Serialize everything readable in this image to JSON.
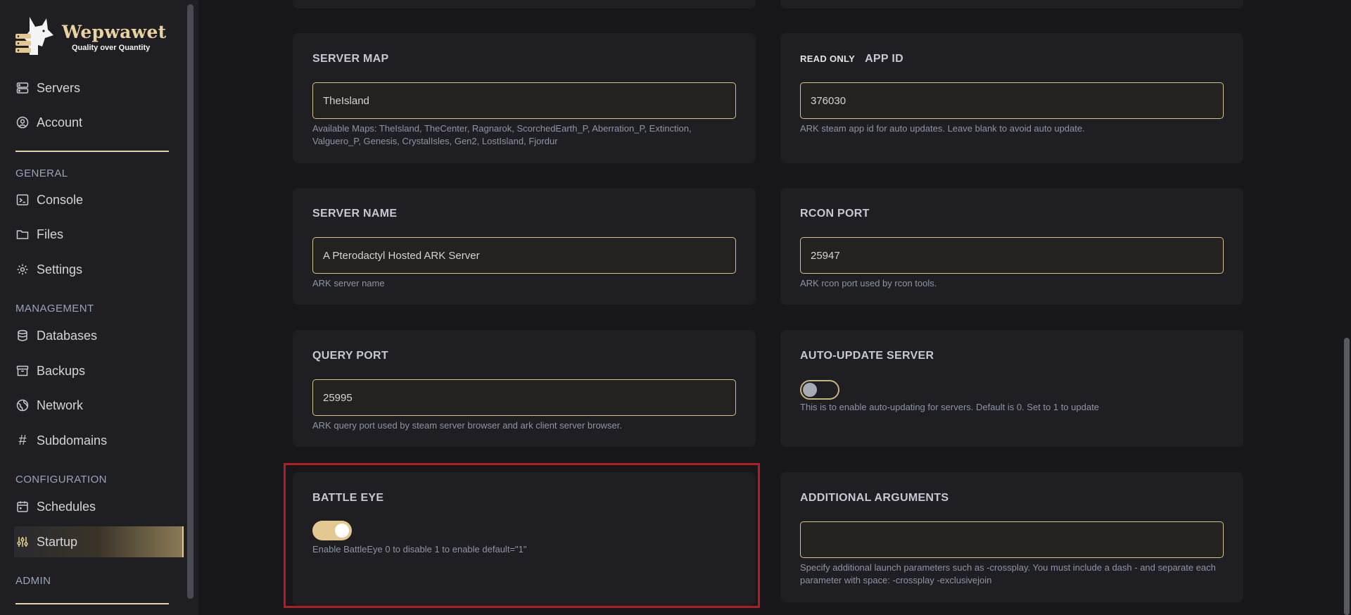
{
  "brand": {
    "name": "Wepwawet",
    "tagline": "Quality over Quantity"
  },
  "nav": {
    "top": [
      {
        "label": "Servers",
        "icon": "server-icon"
      },
      {
        "label": "Account",
        "icon": "account-icon"
      }
    ],
    "general_title": "GENERAL",
    "general": [
      {
        "label": "Console",
        "icon": "terminal-icon"
      },
      {
        "label": "Files",
        "icon": "folder-icon"
      },
      {
        "label": "Settings",
        "icon": "gear-icon"
      }
    ],
    "management_title": "MANAGEMENT",
    "management": [
      {
        "label": "Databases",
        "icon": "database-icon"
      },
      {
        "label": "Backups",
        "icon": "archive-icon"
      },
      {
        "label": "Network",
        "icon": "globe-icon"
      },
      {
        "label": "Subdomains",
        "icon": "hash-icon"
      }
    ],
    "configuration_title": "CONFIGURATION",
    "configuration": [
      {
        "label": "Schedules",
        "icon": "calendar-icon"
      },
      {
        "label": "Startup",
        "icon": "sliders-icon",
        "active": true
      }
    ],
    "admin_title": "ADMIN"
  },
  "variables": {
    "server_map": {
      "label": "SERVER MAP",
      "value": "TheIsland",
      "hint": "Available Maps: TheIsland, TheCenter, Ragnarok, ScorchedEarth_P, Aberration_P, Extinction, Valguero_P, Genesis, CrystalIsles, Gen2, LostIsland, Fjordur"
    },
    "app_id": {
      "readonly_badge": "READ ONLY",
      "label": "APP ID",
      "value": "376030",
      "hint": "ARK steam app id for auto updates. Leave blank to avoid auto update."
    },
    "server_name": {
      "label": "SERVER NAME",
      "value": "A Pterodactyl Hosted ARK Server",
      "hint": "ARK server name"
    },
    "rcon_port": {
      "label": "RCON PORT",
      "value": "25947",
      "hint": "ARK rcon port used by rcon tools."
    },
    "query_port": {
      "label": "QUERY PORT",
      "value": "25995",
      "hint": "ARK query port used by steam server browser and ark client server browser."
    },
    "auto_update": {
      "label": "AUTO-UPDATE SERVER",
      "enabled": false,
      "hint": "This is to enable auto-updating for servers. Default is 0. Set to 1 to update"
    },
    "battle_eye": {
      "label": "BATTLE EYE",
      "enabled": true,
      "hint": "Enable BattleEye 0 to disable 1 to enable default=\"1\""
    },
    "additional_args": {
      "label": "ADDITIONAL ARGUMENTS",
      "value": "",
      "hint": "Specify additional launch parameters such as -crossplay. You must include a dash - and separate each parameter with space: -crossplay -exclusivejoin"
    }
  },
  "colors": {
    "accent": "#e3c98f",
    "highlight_border": "#b01e22"
  }
}
